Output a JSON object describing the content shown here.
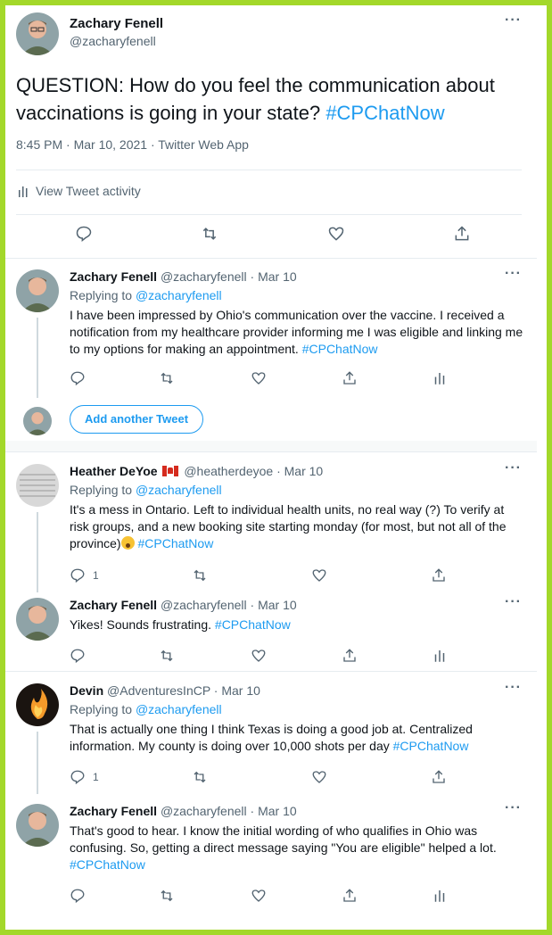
{
  "main_tweet": {
    "author_name": "Zachary Fenell",
    "author_handle": "@zacharyfenell",
    "more": "···",
    "text_prefix": "QUESTION: How do you feel the communication about vaccinations is going in your state? ",
    "hashtag": "#CPChatNow",
    "meta": "8:45 PM · Mar 10, 2021 · Twitter Web App",
    "activity_label": "View Tweet activity"
  },
  "replies": [
    {
      "name": "Zachary Fenell",
      "handle_date": "@zacharyfenell · Mar 10",
      "replying_label": "Replying to ",
      "replying_to": "@zacharyfenell",
      "text": "I have been impressed by Ohio's communication over the vaccine. I received a notification from my healthcare provider informing me I was eligible and linking me to my options for making an appointment. ",
      "hashtag": "#CPChatNow",
      "reply_count": ""
    },
    {
      "name": "Heather DeYoe",
      "handle_date": "@heatherdeyoe · Mar 10",
      "replying_label": "Replying to ",
      "replying_to": "@zacharyfenell",
      "text": "It's a mess in Ontario. Left to individual health units, no real way (?) To verify at risk groups, and a new booking site starting monday (for most, but not all of the province)",
      "hashtag": "#CPChatNow",
      "reply_count": "1"
    },
    {
      "name": "Zachary Fenell",
      "handle_date": "@zacharyfenell · Mar 10",
      "text": "Yikes! Sounds frustrating. ",
      "hashtag": "#CPChatNow",
      "reply_count": ""
    },
    {
      "name": "Devin",
      "handle_date": "@AdventuresInCP · Mar 10",
      "replying_label": "Replying to ",
      "replying_to": "@zacharyfenell",
      "text": "That is actually one thing I think Texas is doing a good job at. Centralized information. My county is doing over 10,000 shots per day ",
      "hashtag": "#CPChatNow",
      "reply_count": "1"
    },
    {
      "name": "Zachary Fenell",
      "handle_date": "@zacharyfenell · Mar 10",
      "text": "That's good to hear. I know the initial wording of who qualifies in Ohio was confusing. So, getting a direct message saying \"You are eligible\" helped a lot. ",
      "hashtag": "#CPChatNow",
      "reply_count": ""
    }
  ],
  "add_another_tweet": "Add another Tweet",
  "colors": {
    "frame": "#a3d82a",
    "link": "#1d9bf0",
    "muted": "#536471",
    "divider": "#e6ecf0"
  }
}
